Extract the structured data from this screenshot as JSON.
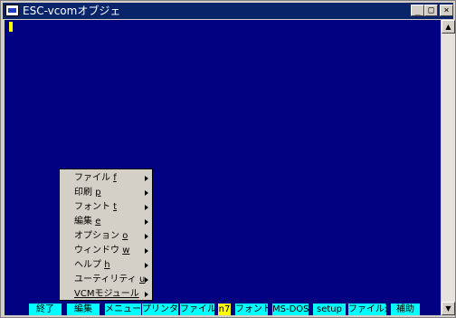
{
  "window": {
    "title": "ESC-vcomオブジェ",
    "buttons": {
      "minimize": "_",
      "maximize": "□",
      "close": "×"
    }
  },
  "menu": {
    "items": [
      {
        "label": "ファイル ",
        "key": "f"
      },
      {
        "label": "印刷 ",
        "key": "p"
      },
      {
        "label": "フォント ",
        "key": "t"
      },
      {
        "label": "編集 ",
        "key": "e"
      },
      {
        "label": "オプション ",
        "key": "o"
      },
      {
        "label": "ウィンドウ ",
        "key": "w"
      },
      {
        "label": "ヘルプ ",
        "key": "h"
      },
      {
        "label": "ユーティリティ ",
        "key": "u"
      },
      {
        "label": "VCMモジュール",
        "key": ""
      }
    ]
  },
  "function_keys": [
    "終了",
    "編集",
    "メニュー",
    "プリンター",
    "ファイル受",
    "n7",
    "フォント",
    "MS-DOS",
    "setup",
    "ファイル送",
    "補助"
  ],
  "colors": {
    "screen": "#000080",
    "function_key": "#00ffff",
    "highlight": "#ffff00",
    "titlebar": "#0a246a"
  }
}
